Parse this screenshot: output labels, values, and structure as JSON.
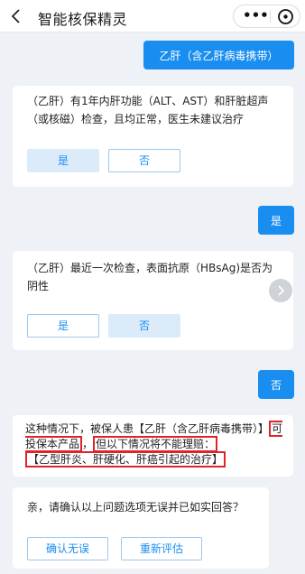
{
  "header": {
    "title": "智能核保精灵",
    "more_label": "•••"
  },
  "messages": {
    "user1": "乙肝（含乙肝病毒携带）",
    "bot1": "（乙肝）有1年内肝功能（ALT、AST）和肝脏超声（或核磁）检查，且均正常，医生未建议治疗",
    "bot1_yes": "是",
    "bot1_no": "否",
    "user2": "是",
    "bot2": "（乙肝）最近一次检查，表面抗原（HBsAg)是否为阴性",
    "bot2_yes": "是",
    "bot2_no": "否",
    "user3": "否",
    "bot3_part1": "这种情况下，被保人患【乙肝（含乙肝病毒携带）】",
    "bot3_hl1": "可投保本产品",
    "bot3_comma": "，",
    "bot3_hl2": "但以下情况将不能理赔：",
    "bot3_hl3": "【乙型肝炎、肝硬化、肝癌引起的治疗】",
    "bot4": "亲，请确认以上问题选项无误并已如实回答？",
    "confirm_label": "确认无误",
    "reassess_label": "重新评估"
  },
  "colors": {
    "accent": "#1a8ef0",
    "selected_bg": "#dcebfa",
    "highlight_border": "#e0222b",
    "page_bg": "#eef1f5"
  }
}
